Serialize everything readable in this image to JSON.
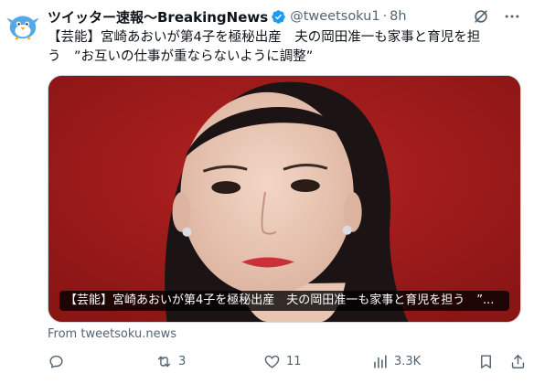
{
  "tweet": {
    "display_name": "ツイッター速報〜BreakingNews",
    "handle": "@tweetsoku1",
    "separator": "·",
    "time": "8h",
    "text": "【芸能】宮崎あおいが第4子を極秘出産　夫の岡田准一も家事と育児を担う　”お互いの仕事が重ならないように調整”",
    "media_caption": "【芸能】宮崎あおいが第4子を極秘出産　夫の岡田准一も家事と育児を担う　”...",
    "source": "From tweetsoku.news",
    "metrics": {
      "replies": "",
      "reposts": "3",
      "likes": "11",
      "views": "3.3K"
    }
  },
  "colors": {
    "text_primary": "#0f1419",
    "text_secondary": "#536471",
    "verified_blue": "#1d9bf0",
    "media_background": "#a01c1c"
  },
  "icons": {
    "avatar": "blue-bird-avatar",
    "verified": "verified-badge-icon",
    "grok": "grok-icon",
    "more": "more-options-icon",
    "reply": "reply-icon",
    "repost": "repost-icon",
    "like": "heart-icon",
    "views": "views-icon",
    "bookmark": "bookmark-icon",
    "share": "share-icon"
  }
}
